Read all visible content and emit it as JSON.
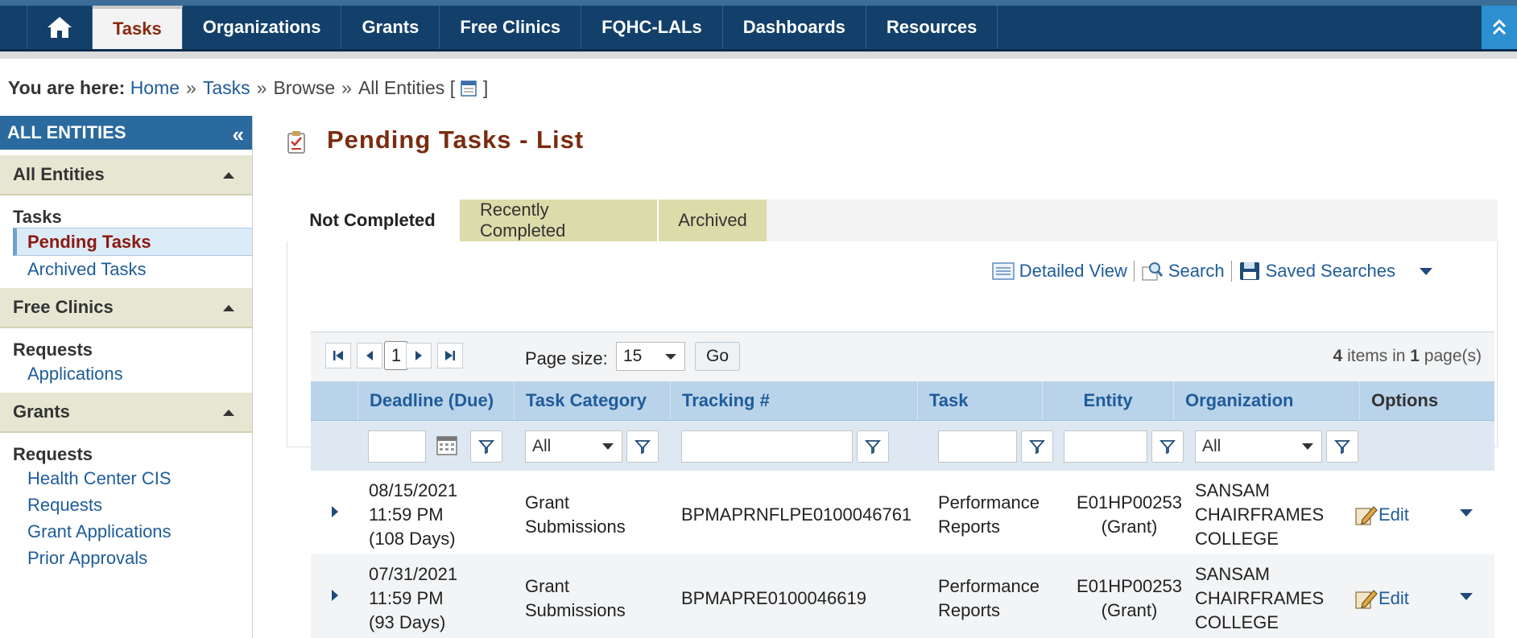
{
  "nav": {
    "home_icon": "home-icon",
    "items": [
      {
        "label": "Tasks",
        "active": true
      },
      {
        "label": "Organizations"
      },
      {
        "label": "Grants"
      },
      {
        "label": "Free Clinics"
      },
      {
        "label": "FQHC-LALs"
      },
      {
        "label": "Dashboards"
      },
      {
        "label": "Resources"
      }
    ],
    "collapse_icon": "double-chevron-up-icon"
  },
  "breadcrumb": {
    "label": "You are here:",
    "items": [
      "Home",
      "Tasks",
      "Browse",
      "All Entities"
    ],
    "sep": "»",
    "open": "[",
    "close": "]"
  },
  "sidebar": {
    "title": "ALL ENTITIES",
    "collapse": "«",
    "sections": [
      {
        "title": "All Entities",
        "sub": "Tasks",
        "links": [
          "Pending Tasks",
          "Archived Tasks"
        ]
      },
      {
        "title": "Free Clinics",
        "sub": "Requests",
        "links": [
          "Applications"
        ]
      },
      {
        "title": "Grants",
        "sub": "Requests",
        "links": [
          "Health Center CIS",
          "Requests",
          "Grant Applications",
          "Prior Approvals"
        ]
      }
    ]
  },
  "main": {
    "title": "Pending Tasks - List",
    "tabs": [
      "Not Completed",
      "Recently Completed",
      "Archived"
    ],
    "tools": {
      "detailed": "Detailed View",
      "search": "Search",
      "saved": "Saved Searches"
    }
  },
  "pager": {
    "page": "1",
    "size_label": "Page size:",
    "size": "15",
    "go": "Go",
    "items_count": "4",
    "items_text": "items in",
    "pages_count": "1",
    "pages_text": "page(s)"
  },
  "grid": {
    "columns": [
      "Deadline (Due)",
      "Task Category",
      "Tracking #",
      "Task",
      "Entity",
      "Organization",
      "Options"
    ],
    "filters": {
      "category": "All",
      "organization": "All"
    },
    "rows": [
      {
        "deadline": [
          "08/15/2021",
          "11:59 PM",
          "(108 Days)"
        ],
        "category": [
          "Grant",
          "Submissions"
        ],
        "tracking": "BPMAPRNFLPE0100046761",
        "task": [
          "Performance",
          "Reports"
        ],
        "entity": [
          "E01HP00253",
          "(Grant)"
        ],
        "org": [
          "SANSAM",
          "CHAIRFRAMES",
          "COLLEGE"
        ],
        "edit": "Edit"
      },
      {
        "deadline": [
          "07/31/2021",
          "11:59 PM",
          "(93 Days)"
        ],
        "category": [
          "Grant",
          "Submissions"
        ],
        "tracking": "BPMAPRE0100046619",
        "task": [
          "Performance",
          "Reports"
        ],
        "entity": [
          "E01HP00253",
          "(Grant)"
        ],
        "org": [
          "SANSAM",
          "CHAIRFRAMES",
          "COLLEGE"
        ],
        "edit": "Edit"
      }
    ]
  }
}
